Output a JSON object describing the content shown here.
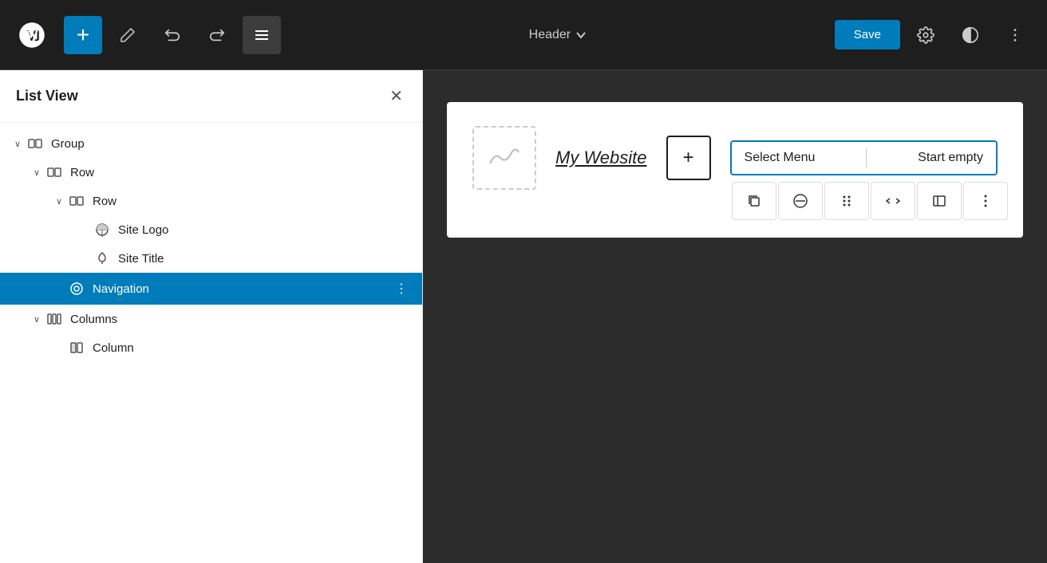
{
  "toolbar": {
    "add_label": "+",
    "edit_label": "✏",
    "undo_label": "↩",
    "redo_label": "↪",
    "list_view_label": "≡",
    "header_label": "Header",
    "chevron_down": "∨",
    "save_label": "Save",
    "settings_label": "⚙",
    "style_label": "◑",
    "more_label": "⋮"
  },
  "sidebar": {
    "title": "List View",
    "close_label": "✕",
    "items": [
      {
        "id": "group",
        "label": "Group",
        "indent": 0,
        "chevron": "∨",
        "icon": "group"
      },
      {
        "id": "row1",
        "label": "Row",
        "indent": 1,
        "chevron": "∨",
        "icon": "row"
      },
      {
        "id": "row2",
        "label": "Row",
        "indent": 2,
        "chevron": "∨",
        "icon": "row"
      },
      {
        "id": "site-logo",
        "label": "Site Logo",
        "indent": 3,
        "chevron": "",
        "icon": "logo"
      },
      {
        "id": "site-title",
        "label": "Site Title",
        "indent": 3,
        "chevron": "",
        "icon": "pin"
      },
      {
        "id": "navigation",
        "label": "Navigation",
        "indent": 2,
        "chevron": "",
        "icon": "nav",
        "active": true
      },
      {
        "id": "columns",
        "label": "Columns",
        "indent": 1,
        "chevron": "∨",
        "icon": "columns"
      },
      {
        "id": "column",
        "label": "Column",
        "indent": 2,
        "chevron": "",
        "icon": "column"
      }
    ]
  },
  "canvas": {
    "site_title": "My Website",
    "nav_select": "Select Menu",
    "nav_divider": "|",
    "nav_start_empty": "Start empty",
    "add_block_label": "+",
    "nav_tools": [
      {
        "id": "duplicate",
        "icon": "⧉"
      },
      {
        "id": "no-entry",
        "icon": "⊘"
      },
      {
        "id": "drag",
        "icon": "⠿"
      },
      {
        "id": "code",
        "icon": "‹›"
      },
      {
        "id": "align",
        "icon": "▐"
      },
      {
        "id": "more",
        "icon": "⋮"
      }
    ]
  },
  "icons": {
    "group_icon": "⬜",
    "row_icon": "⬜",
    "logo_icon": "◑",
    "pin_icon": "⬟",
    "nav_icon": "◎",
    "columns_icon": "⬛",
    "column_icon": "▐"
  }
}
